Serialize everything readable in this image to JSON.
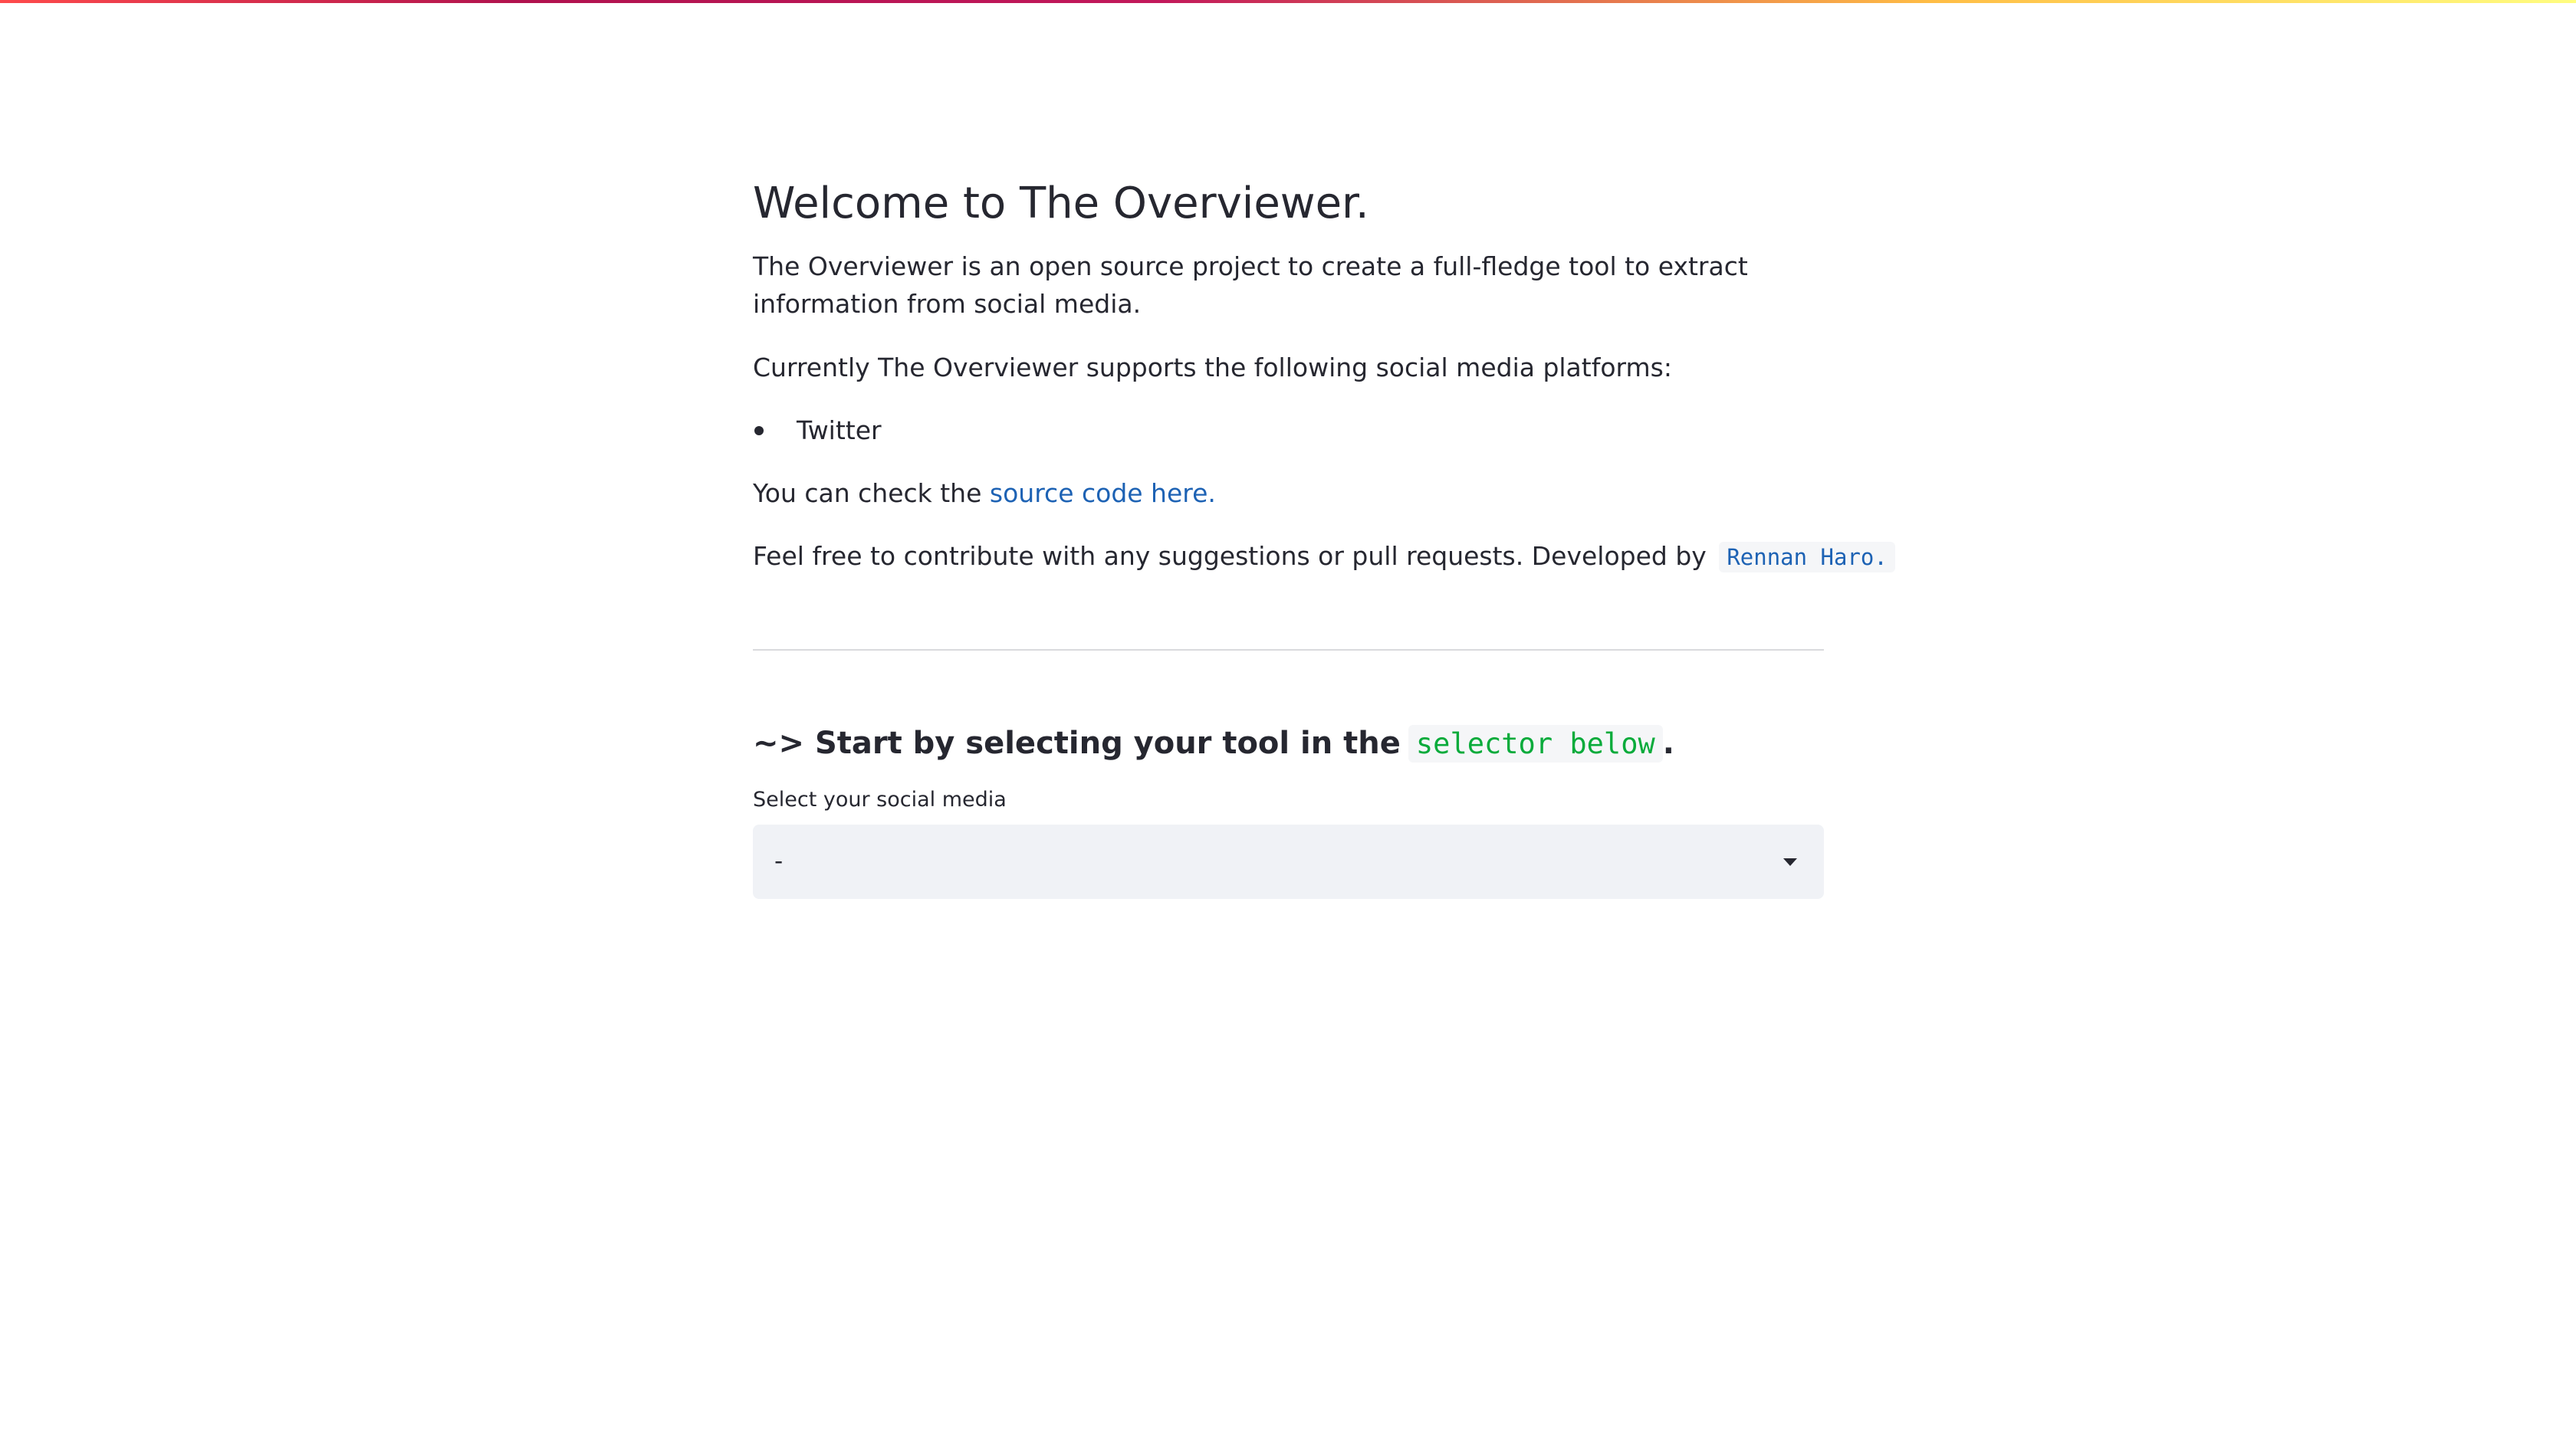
{
  "colors": {
    "accent_link": "#1d62b4",
    "code_green": "#09ab3b",
    "text": "#262730",
    "select_bg": "#f0f2f6"
  },
  "header": {
    "title": "Welcome to The Overviewer."
  },
  "intro": {
    "description": "The Overviewer is an open source project to create a full-fledge tool to extract information from social media.",
    "supports_text": "Currently The Overviewer supports the following social media platforms:",
    "platforms": [
      "Twitter"
    ],
    "source_prefix": "You can check the ",
    "source_link": "source code here.",
    "contribute_text": "Feel free to contribute with any suggestions or pull requests. Developed by",
    "author": "Rennan Haro."
  },
  "selector_section": {
    "heading_prefix": "~> Start by selecting your tool in the",
    "heading_code": "selector below",
    "heading_suffix": ".",
    "label": "Select your social media",
    "selected_value": "-"
  },
  "icons": {
    "select_caret": "chevron-down-icon"
  }
}
